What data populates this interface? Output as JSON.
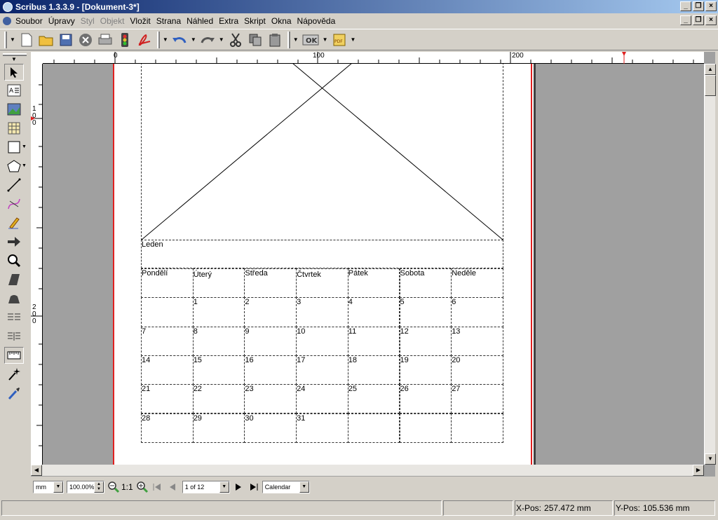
{
  "window": {
    "title": "Scribus 1.3.3.9 - [Dokument-3*]"
  },
  "menu": [
    "Soubor",
    "Úpravy",
    "Styl",
    "Objekt",
    "Vložit",
    "Strana",
    "Náhled",
    "Extra",
    "Skript",
    "Okna",
    "Nápověda"
  ],
  "menu_disabled": [
    "Styl",
    "Objekt"
  ],
  "ruler": {
    "h_labels": [
      "0",
      "100",
      "200"
    ],
    "v_labels": [
      "1\n0\n0",
      "2\n0\n0"
    ]
  },
  "calendar": {
    "month": "Leden",
    "days": [
      "Pondělí",
      "Úterý",
      "Středa",
      "Čtvrtek",
      "Pátek",
      "Sobota",
      "Neděle"
    ],
    "weeks": [
      [
        "",
        "1",
        "2",
        "3",
        "4",
        "5",
        "6"
      ],
      [
        "7",
        "8",
        "9",
        "10",
        "11",
        "12",
        "13"
      ],
      [
        "14",
        "15",
        "16",
        "17",
        "18",
        "19",
        "20"
      ],
      [
        "21",
        "22",
        "23",
        "24",
        "25",
        "26",
        "27"
      ],
      [
        "28",
        "29",
        "30",
        "31",
        "",
        "",
        ""
      ]
    ]
  },
  "bottom": {
    "unit": "mm",
    "zoom": "100.00%",
    "ratio": "1:1",
    "page": "1 of 12",
    "layer": "Calendar"
  },
  "status": {
    "xpos_label": "X-Pos:",
    "xpos_value": "257.472 mm",
    "ypos_label": "Y-Pos:",
    "ypos_value": "105.536 mm"
  }
}
